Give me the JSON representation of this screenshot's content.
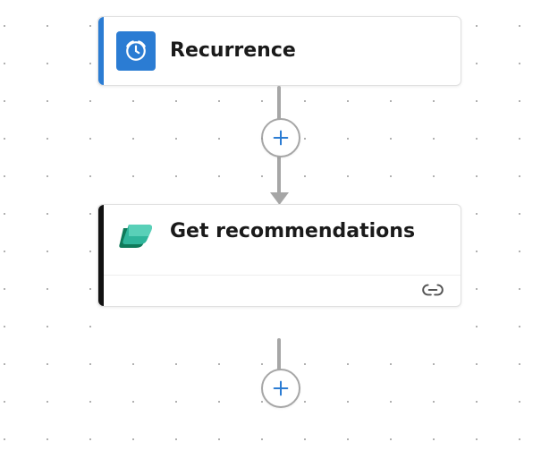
{
  "nodes": {
    "trigger": {
      "title": "Recurrence",
      "accent": "#2b7cd3",
      "icon": "clock-icon"
    },
    "action": {
      "title": "Get recommendations",
      "accent": "#0f6b4f",
      "icon": "power-platform-icon"
    }
  },
  "buttons": {
    "add": "+"
  },
  "footer_icon": "link-icon",
  "colors": {
    "plus": "#2b7cd3",
    "connector": "#a6a6a6"
  }
}
